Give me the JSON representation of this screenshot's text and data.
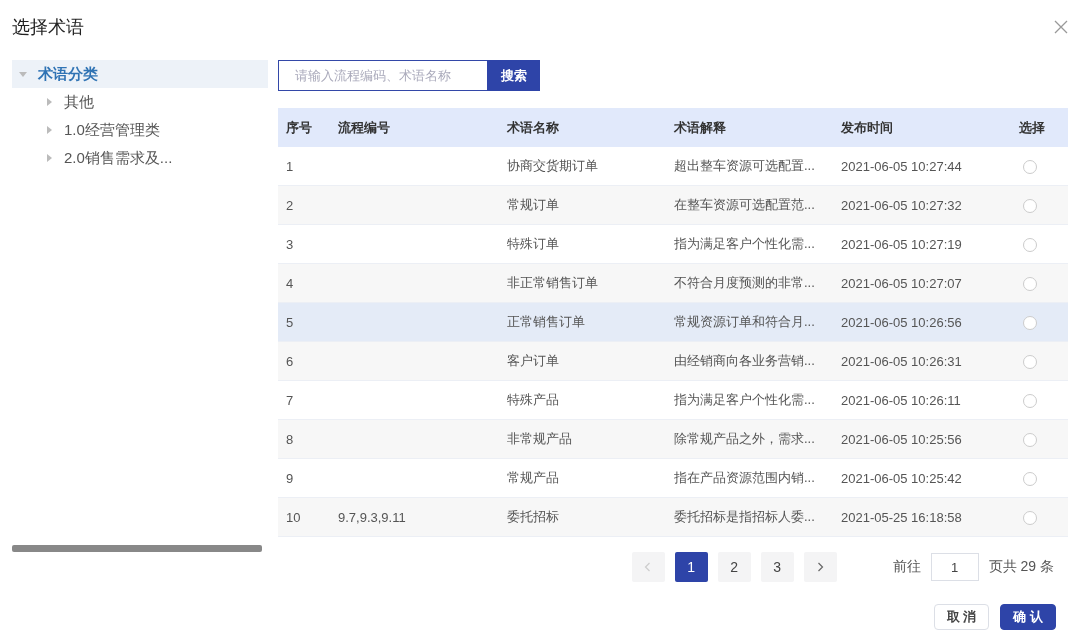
{
  "dialog": {
    "title": "选择术语"
  },
  "tree": {
    "root": {
      "label": "术语分类",
      "expanded": true,
      "selected": true,
      "children": [
        {
          "label": "其他",
          "expanded": false
        },
        {
          "label": "1.0经营管理类",
          "expanded": false
        },
        {
          "label": "2.0销售需求及...",
          "expanded": false
        }
      ]
    }
  },
  "search": {
    "placeholder": "请输入流程编码、术语名称",
    "button": "搜索"
  },
  "table": {
    "columns": [
      "序号",
      "流程编号",
      "术语名称",
      "术语解释",
      "发布时间",
      "选择"
    ],
    "rows": [
      {
        "cells": [
          "1",
          "",
          "协商交货期订单",
          "超出整车资源可选配置...",
          "2021-06-05 10:27:44"
        ],
        "selected": false,
        "highlighted": false
      },
      {
        "cells": [
          "2",
          "",
          "常规订单",
          "在整车资源可选配置范...",
          "2021-06-05 10:27:32"
        ],
        "selected": false,
        "highlighted": false
      },
      {
        "cells": [
          "3",
          "",
          "特殊订单",
          "指为满足客户个性化需...",
          "2021-06-05 10:27:19"
        ],
        "selected": false,
        "highlighted": false
      },
      {
        "cells": [
          "4",
          "",
          "非正常销售订单",
          "不符合月度预测的非常...",
          "2021-06-05 10:27:07"
        ],
        "selected": false,
        "highlighted": false
      },
      {
        "cells": [
          "5",
          "",
          "正常销售订单",
          "常规资源订单和符合月...",
          "2021-06-05 10:26:56"
        ],
        "selected": false,
        "highlighted": true
      },
      {
        "cells": [
          "6",
          "",
          "客户订单",
          "由经销商向各业务营销...",
          "2021-06-05 10:26:31"
        ],
        "selected": false,
        "highlighted": false
      },
      {
        "cells": [
          "7",
          "",
          "特殊产品",
          "指为满足客户个性化需...",
          "2021-06-05 10:26:11"
        ],
        "selected": false,
        "highlighted": false
      },
      {
        "cells": [
          "8",
          "",
          "非常规产品",
          "除常规产品之外，需求...",
          "2021-06-05 10:25:56"
        ],
        "selected": false,
        "highlighted": false
      },
      {
        "cells": [
          "9",
          "",
          "常规产品",
          "指在产品资源范围内销...",
          "2021-06-05 10:25:42"
        ],
        "selected": false,
        "highlighted": false
      },
      {
        "cells": [
          "10",
          "9.7,9.3,9.11",
          "委托招标",
          "委托招标是指招标人委...",
          "2021-05-25 16:18:58"
        ],
        "selected": false,
        "highlighted": false
      }
    ]
  },
  "pagination": {
    "prev_disabled": true,
    "pages": [
      {
        "label": "1",
        "selected": true
      },
      {
        "label": "2",
        "selected": false
      },
      {
        "label": "3",
        "selected": false
      }
    ],
    "goto_label": "前往",
    "goto_value": "1",
    "total": "页共 29 条"
  },
  "buttons": [
    {
      "label": "取 消",
      "kind": "secondary"
    },
    {
      "label": "确 认",
      "kind": "primary"
    }
  ]
}
